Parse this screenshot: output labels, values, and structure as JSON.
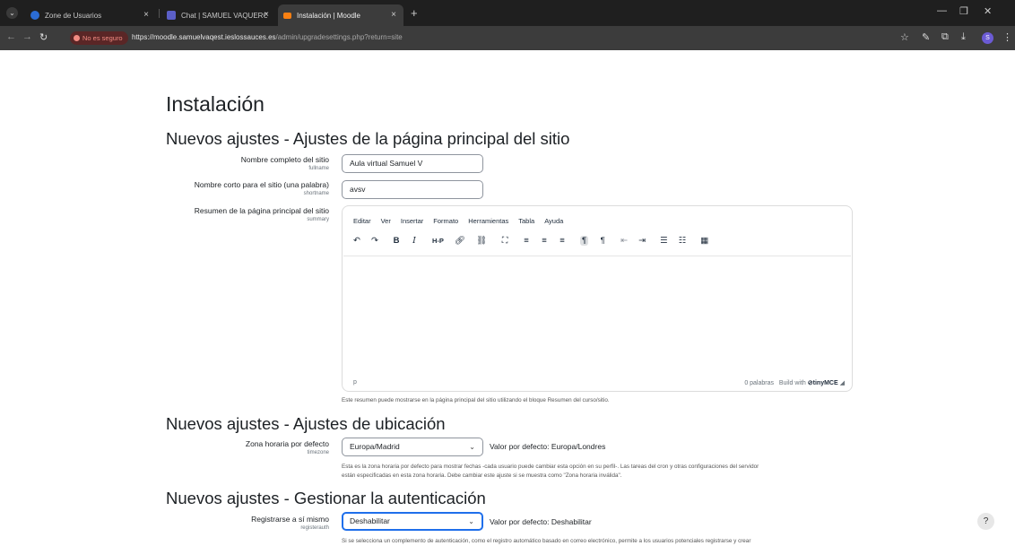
{
  "browser": {
    "tabs": [
      {
        "title": "Zone de Usuarios",
        "favicon_color": "#2b6cd4"
      },
      {
        "title": "Chat | SAMUEL VAQUERO ESTI",
        "favicon_color": "#5b5fc7"
      },
      {
        "title": "Instalación | Moodle",
        "favicon_color": "#f98012"
      }
    ],
    "new_tab": "+",
    "security_badge": "No es seguro",
    "url_host": "https://moodle.samuelvaqest.ieslossauces.es",
    "url_path": "/admin/upgradesettings.php?return=site",
    "profile_initial": "S"
  },
  "page": {
    "title": "Instalación",
    "sections": {
      "frontpage": "Nuevos ajustes - Ajustes de la página principal del sitio",
      "location": "Nuevos ajustes - Ajustes de ubicación",
      "auth": "Nuevos ajustes - Gestionar la autenticación"
    },
    "fields": {
      "fullname": {
        "label": "Nombre completo del sitio",
        "name": "fullname",
        "value": "Aula virtual Samuel V"
      },
      "shortname": {
        "label": "Nombre corto para el sitio (una palabra)",
        "name": "shortname",
        "value": "avsv"
      },
      "summary": {
        "label": "Resumen de la página principal del sitio",
        "name": "summary",
        "help": "Este resumen puede mostrarse en la página principal del sitio utilizando el bloque Resumen del curso/sitio."
      },
      "timezone": {
        "label": "Zona horaria por defecto",
        "name": "timezone",
        "value": "Europa/Madrid",
        "default": "Valor por defecto: Europa/Londres",
        "help_1": "Esta es la zona horaria por defecto para mostrar fechas -cada usuario puede cambiar esta opción en su perfil-. Las tareas del cron y otras configuraciones del servidor",
        "help_2": "están especificadas en esta zona horaria. Debe cambiar este ajuste si se muestra como \"Zona horaria inválida\"."
      },
      "registerauth": {
        "label": "Registrarse a sí mismo",
        "name": "registerauth",
        "value": "Deshabilitar",
        "default": "Valor por defecto: Deshabilitar",
        "help": "Si se selecciona un complemento de autenticación, como el registro automático basado en correo electrónico, permite a los usuarios potenciales registrarse y crear"
      }
    },
    "editor": {
      "menu": [
        "Editar",
        "Ver",
        "Insertar",
        "Formato",
        "Herramientas",
        "Tabla",
        "Ayuda"
      ],
      "path": "p",
      "word_count": "0 palabras",
      "built_with": "Build with",
      "brand": "tinyMCE"
    },
    "help_button": "?"
  }
}
